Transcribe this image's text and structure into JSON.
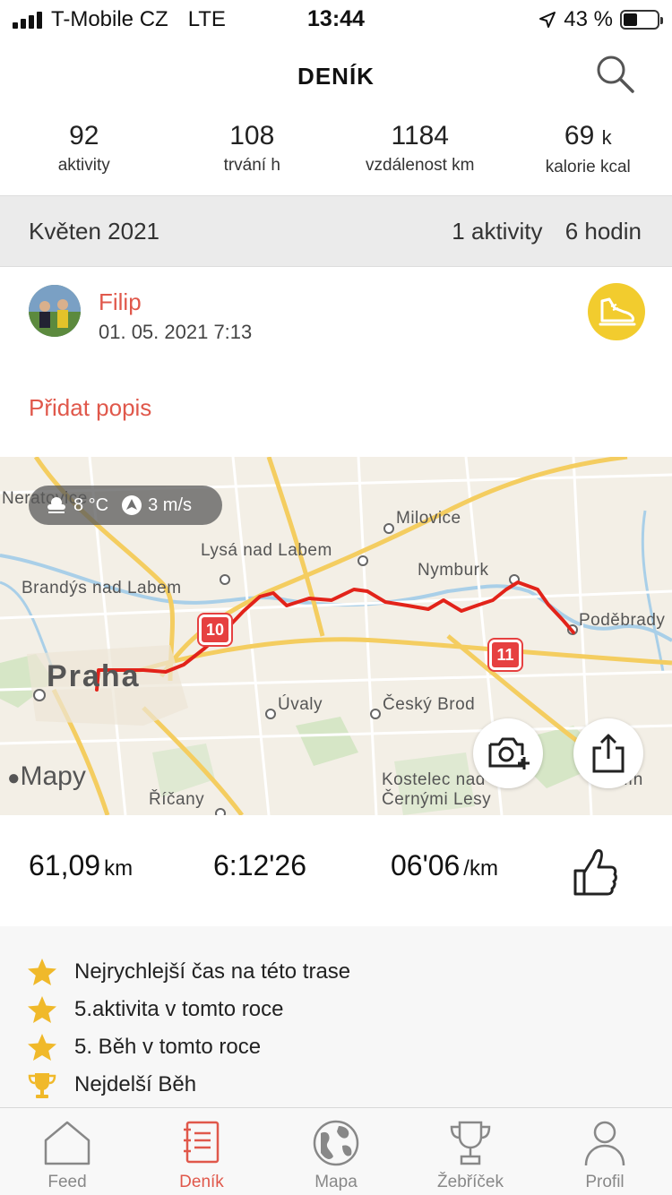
{
  "status_bar": {
    "carrier": "T-Mobile CZ",
    "network": "LTE",
    "time": "13:44",
    "battery": "43 %",
    "battery_level": 0.43
  },
  "header": {
    "title": "DENÍK"
  },
  "stats": [
    {
      "value": "92",
      "suffix": "",
      "label": "aktivity"
    },
    {
      "value": "108",
      "suffix": "",
      "label": "trvání h"
    },
    {
      "value": "1184",
      "suffix": "",
      "label": "vzdálenost km"
    },
    {
      "value": "69",
      "suffix": "k",
      "label": "kalorie kcal"
    }
  ],
  "month": {
    "name": "Květen 2021",
    "activities": "1 aktivity",
    "hours": "6 hodin"
  },
  "activity": {
    "user": "Filip",
    "date": "01. 05. 2021 7:13",
    "add_description": "Přidat popis",
    "sport_icon": "running-shoe-icon"
  },
  "map": {
    "weather_temp": "8 °C",
    "weather_wind": "3 m/s",
    "attribution": "Mapy",
    "cities": {
      "neratovice": "Neratovice",
      "milovice": "Milovice",
      "lysa": "Lysá nad Labem",
      "nymburk": "Nymburk",
      "brandys": "Brandýs nad Labem",
      "podebrady": "Poděbrady",
      "praha": "Praha",
      "uvaly": "Úvaly",
      "cesky_brod": "Český Brod",
      "kostelec_1": "Kostelec nad",
      "kostelec_2": "Černými Lesy",
      "ricany": "Říčany",
      "kolin": "Kolín"
    },
    "shield_10": "10",
    "shield_11": "11",
    "route_color": "#e2231a"
  },
  "metrics": {
    "distance_value": "61,09",
    "distance_unit": "km",
    "duration": "6:12'26",
    "pace_value": "06'06",
    "pace_unit": "/km"
  },
  "achievements": [
    {
      "icon": "star-icon",
      "text": "Nejrychlejší čas na této trase"
    },
    {
      "icon": "star-icon",
      "text": "5.aktivita v tomto roce"
    },
    {
      "icon": "star-icon",
      "text": "5. Běh v tomto roce"
    },
    {
      "icon": "trophy-icon",
      "text": "Nejdelší Běh"
    }
  ],
  "tabs": [
    {
      "label": "Feed",
      "icon": "home-icon"
    },
    {
      "label": "Deník",
      "icon": "diary-icon",
      "active": true
    },
    {
      "label": "Mapa",
      "icon": "globe-icon"
    },
    {
      "label": "Žebříček",
      "icon": "trophy-icon"
    },
    {
      "label": "Profil",
      "icon": "person-icon"
    }
  ],
  "colors": {
    "accent": "#e0584b",
    "badge_yellow": "#f2cc2e",
    "star_yellow": "#f0b92a"
  }
}
